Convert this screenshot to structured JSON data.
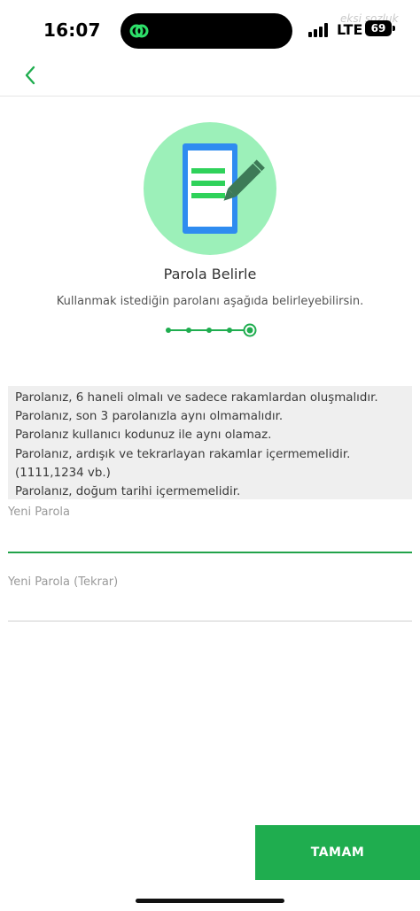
{
  "status_bar": {
    "time": "16:07",
    "network": "LTE",
    "battery": "69",
    "watermark": "eksi sozluk"
  },
  "header": {
    "back_icon": "chevron-left-icon"
  },
  "hero": {
    "icon": "phone-document-pen-icon",
    "title": "Parola Belirle",
    "subtitle": "Kullanmak istediğin parolanı aşağıda belirleyebilirsin."
  },
  "stepper": {
    "total_steps": 5,
    "current_step": 5
  },
  "rules": [
    "Parolanız, 6 haneli olmalı ve sadece rakamlardan oluşmalıdır.",
    "Parolanız, son 3 parolanızla aynı olmamalıdır.",
    "Parolanız kullanıcı kodunuz ile aynı olamaz.",
    "Parolanız, ardışık ve tekrarlayan rakamlar içermemelidir.",
    "(1111,1234 vb.)",
    "Parolanız, doğum tarihi içermemelidir."
  ],
  "form": {
    "new_password_label": "Yeni Parola",
    "new_password_value": "",
    "confirm_password_label": "Yeni Parola (Tekrar)",
    "confirm_password_value": ""
  },
  "actions": {
    "confirm_label": "TAMAM"
  },
  "colors": {
    "accent": "#1fad4f",
    "hero_circle": "#9cf0b9",
    "phone_screen": "#2f8cf0",
    "rules_bg": "#efefef"
  }
}
